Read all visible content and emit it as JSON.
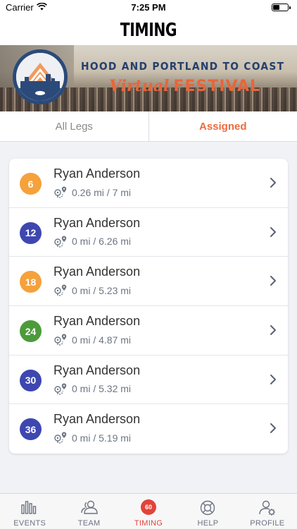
{
  "status_bar": {
    "carrier": "Carrier",
    "time": "7:25 PM"
  },
  "header": {
    "title": "TIMING"
  },
  "banner": {
    "headline": "HOOD AND PORTLAND TO COAST",
    "virtual": "Virtual",
    "festival": "FESTIVAL"
  },
  "tabs": [
    {
      "label": "All Legs",
      "active": false
    },
    {
      "label": "Assigned",
      "active": true
    }
  ],
  "legs": [
    {
      "number": "6",
      "color": "#f5a13c",
      "name": "Ryan Anderson",
      "distance": "0.26 mi / 7 mi"
    },
    {
      "number": "12",
      "color": "#3e47b0",
      "name": "Ryan Anderson",
      "distance": "0 mi / 6.26 mi"
    },
    {
      "number": "18",
      "color": "#f5a13c",
      "name": "Ryan Anderson",
      "distance": "0 mi / 5.23 mi"
    },
    {
      "number": "24",
      "color": "#4c9b3a",
      "name": "Ryan Anderson",
      "distance": "0 mi / 4.87 mi"
    },
    {
      "number": "30",
      "color": "#3e47b0",
      "name": "Ryan Anderson",
      "distance": "0 mi / 5.32 mi"
    },
    {
      "number": "36",
      "color": "#3e47b0",
      "name": "Ryan Anderson",
      "distance": "0 mi / 5.19 mi"
    }
  ],
  "tab_bar": {
    "items": [
      {
        "label": "EVENTS",
        "icon": "bar-chart-icon",
        "active": false
      },
      {
        "label": "TEAM",
        "icon": "team-icon",
        "active": false
      },
      {
        "label": "TIMING",
        "icon": "timing-icon",
        "active": true,
        "badge": "60"
      },
      {
        "label": "HELP",
        "icon": "lifebuoy-icon",
        "active": false
      },
      {
        "label": "PROFILE",
        "icon": "profile-settings-icon",
        "active": false
      }
    ]
  },
  "colors": {
    "accent": "#ef6a3c",
    "active_tab": "#e1443a",
    "text_muted": "#6b7684"
  }
}
